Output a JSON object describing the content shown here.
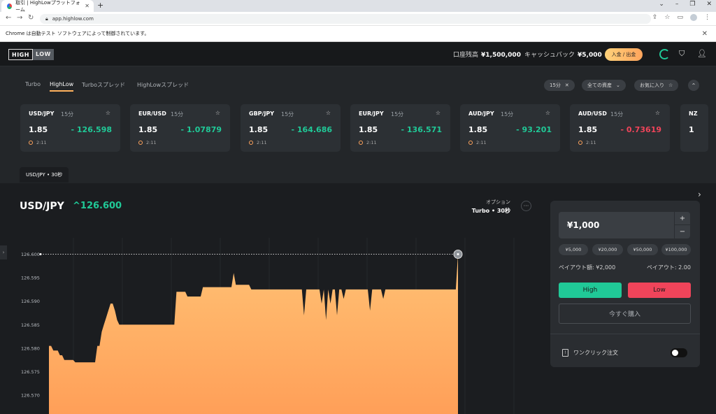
{
  "browser": {
    "tab_title": "取引 | HighLowプラットフォーム",
    "url": "app.highlow.com",
    "infobar": "Chrome は自動テスト ソフトウェアによって制御されています。"
  },
  "header": {
    "logo_hi": "HIGH",
    "logo_lo": "LOW",
    "balance_label": "口座残高",
    "balance": "¥1,500,000",
    "cashback_label": "キャッシュバック",
    "cashback": "¥5,000",
    "deposit_label": "入金 / 出金"
  },
  "tabs": [
    "Turbo",
    "HighLow",
    "Turboスプレッド",
    "HighLowスプレッド"
  ],
  "filters": {
    "duration": "15分",
    "assets": "全ての資産",
    "favorites": "お気に入り"
  },
  "cards": [
    {
      "pair": "USD/JPY",
      "dur": "15分",
      "payout": "1.85",
      "rate": "- 126.598",
      "time": "2:11",
      "dir": "up"
    },
    {
      "pair": "EUR/USD",
      "dur": "15分",
      "payout": "1.85",
      "rate": "- 1.07879",
      "time": "2:11",
      "dir": "up"
    },
    {
      "pair": "GBP/JPY",
      "dur": "15分",
      "payout": "1.85",
      "rate": "- 164.686",
      "time": "2:11",
      "dir": "up"
    },
    {
      "pair": "EUR/JPY",
      "dur": "15分",
      "payout": "1.85",
      "rate": "- 136.571",
      "time": "2:11",
      "dir": "up"
    },
    {
      "pair": "AUD/JPY",
      "dur": "15分",
      "payout": "1.85",
      "rate": "- 93.201",
      "time": "2:11",
      "dir": "up"
    },
    {
      "pair": "AUD/USD",
      "dur": "15分",
      "payout": "1.85",
      "rate": "- 0.73619",
      "time": "2:11",
      "dir": "down"
    },
    {
      "pair": "NZ",
      "dur": "",
      "payout": "1",
      "rate": "",
      "time": "",
      "dir": "up"
    }
  ],
  "active_chip": "USD/JPY • 30秒",
  "main": {
    "asset": "USD/JPY",
    "price": "^126.600",
    "option_label": "オプション",
    "option_value": "Turbo • 30秒",
    "more": "···"
  },
  "chart_data": {
    "type": "area",
    "y_ticks": [
      "126.600",
      "126.595",
      "126.590",
      "126.585",
      "126.580",
      "126.575",
      "126.570"
    ],
    "ylim": [
      126.566,
      126.6035
    ],
    "current_value": 126.6,
    "values": [
      126.5805,
      126.5805,
      126.5795,
      126.5795,
      126.5795,
      126.5785,
      126.5785,
      126.5775,
      126.5775,
      126.5775,
      126.5775,
      126.5775,
      126.577,
      126.577,
      126.577,
      126.577,
      126.577,
      126.577,
      126.577,
      126.577,
      126.577,
      126.577,
      126.5805,
      126.5805,
      126.5835,
      126.585,
      126.5865,
      126.588,
      126.5895,
      126.5895,
      126.588,
      126.586,
      126.585,
      126.585,
      126.585,
      126.585,
      126.585,
      126.585,
      126.585,
      126.585,
      126.585,
      126.585,
      126.585,
      126.585,
      126.585,
      126.585,
      126.585,
      126.585,
      126.585,
      126.585,
      126.585,
      126.585,
      126.585,
      126.585,
      126.585,
      126.585,
      126.585,
      126.585,
      126.592,
      126.592,
      126.592,
      126.592,
      126.592,
      126.591,
      126.591,
      126.591,
      126.591,
      126.591,
      126.591,
      126.591,
      126.593,
      126.593,
      126.593,
      126.593,
      126.593,
      126.593,
      126.593,
      126.593,
      126.593,
      126.593,
      126.593,
      126.593,
      126.593,
      126.593,
      126.596,
      126.5935,
      126.5935,
      126.5935,
      126.5935,
      126.5935,
      126.5935,
      126.5935,
      126.5925,
      126.5925,
      126.5925,
      126.5925,
      126.5925,
      126.5925,
      126.5925,
      126.5925,
      126.5925,
      126.5925,
      126.5925,
      126.5925,
      126.5925,
      126.5925,
      126.5925,
      126.5925,
      126.5925,
      126.5925,
      126.5925,
      126.5925,
      126.5925,
      126.5925,
      126.5925,
      126.5925,
      126.5925,
      126.5925,
      126.5925,
      126.5925,
      126.5925,
      126.5925,
      126.5925,
      126.5925,
      126.5925,
      126.5925,
      126.5925,
      126.5925,
      126.5925,
      126.5925,
      126.5925,
      126.5925,
      126.5925,
      126.5925,
      126.5925,
      126.5925,
      126.5925,
      126.5925,
      126.5925,
      126.5925,
      126.5925,
      126.5925,
      126.5925,
      126.5925,
      126.5925,
      126.5925,
      126.5925,
      126.5925,
      126.5925,
      126.5925,
      126.5925,
      126.5925,
      126.5925,
      126.5925,
      126.5925,
      126.5925,
      126.5925,
      126.5925,
      126.5925,
      126.5925,
      126.5925,
      126.5925,
      126.5925,
      126.5925,
      126.5925,
      126.5925,
      126.5925,
      126.5925,
      126.5925,
      126.5925,
      126.5925,
      126.5925,
      126.5925,
      126.5925,
      126.5925,
      126.5925,
      126.5925,
      126.5925,
      126.5925,
      126.5925,
      126.5925,
      126.5925,
      126.5925,
      126.5925,
      126.5925,
      126.5925,
      126.6
    ],
    "dips": [
      [
        116,
        126.587
      ],
      [
        124,
        126.5895
      ],
      [
        126,
        126.586
      ],
      [
        128,
        126.5895
      ],
      [
        131,
        126.587
      ],
      [
        134,
        126.5905
      ],
      [
        146,
        126.588
      ],
      [
        152,
        126.5905
      ]
    ],
    "area_color": "#ffc174",
    "area_color_bottom": "#ff9f58"
  },
  "panel": {
    "amount": "¥1,000",
    "plus": "+",
    "minus": "−",
    "quick": [
      "¥5,000",
      "¥20,000",
      "¥50,000",
      "¥100,000"
    ],
    "payout_amount_label": "ペイアウト額: ¥2,000",
    "payout_label": "ペイアウト: 2.00",
    "high": "High",
    "low": "Low",
    "buy": "今すぐ購入",
    "one_click": "ワンクリック注文"
  },
  "colors": {
    "up": "#20c997",
    "down": "#f0445a",
    "accent": "#ffb25e"
  }
}
